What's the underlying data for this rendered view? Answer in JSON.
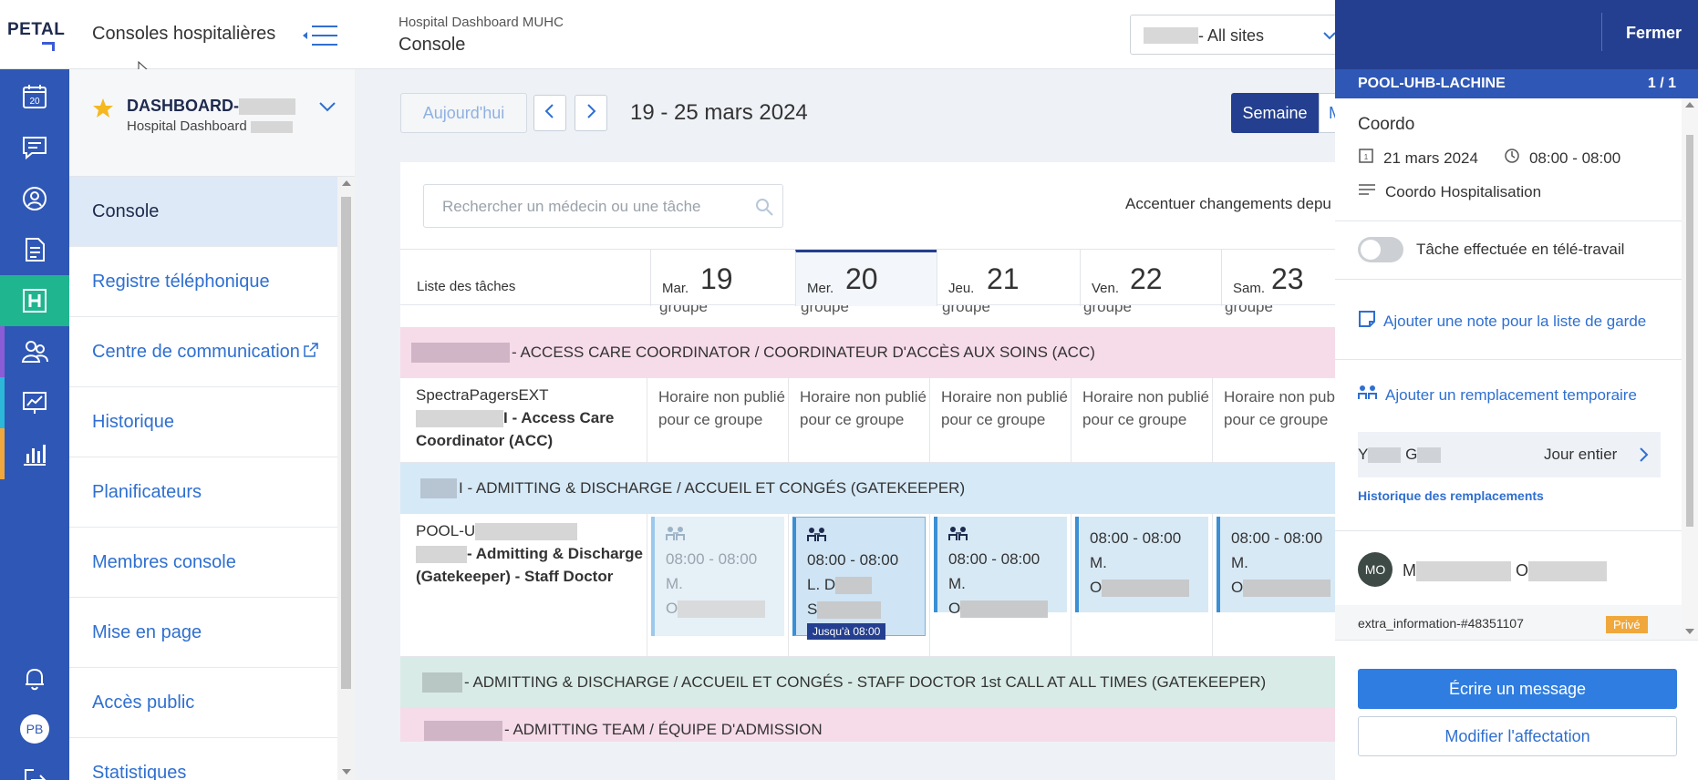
{
  "brand": {
    "logo_text": "PETAL"
  },
  "header": {
    "app_title": "Consoles hospitalières",
    "dashboard_subtitle": "Hospital Dashboard MUHC",
    "dashboard_title": "Console",
    "site_select_value": "- All sites"
  },
  "rail": {
    "calendar_day": "20",
    "user_initials": "PB"
  },
  "sidebar": {
    "dashboard_name": "DASHBOARD-",
    "dashboard_desc": "Hospital Dashboard",
    "items": [
      {
        "label": "Console",
        "active": true
      },
      {
        "label": "Registre téléphonique"
      },
      {
        "label": "Centre de communication",
        "external": true
      },
      {
        "label": "Historique"
      },
      {
        "label": "Planificateurs"
      },
      {
        "label": "Membres console"
      },
      {
        "label": "Mise en page"
      },
      {
        "label": "Accès public"
      },
      {
        "label": "Statistiques"
      }
    ]
  },
  "toolbar": {
    "today_label": "Aujourd'hui",
    "date_range": "19 - 25 mars 2024",
    "week_label": "Semaine",
    "month_label": "M"
  },
  "grid": {
    "search_placeholder": "Rechercher un médecin ou une tâche",
    "accent_label": "Accentuer changements depu",
    "task_list_header": "Liste des tâches",
    "days": [
      {
        "name": "Mar.",
        "num": "19"
      },
      {
        "name": "Mer.",
        "num": "20",
        "today": true
      },
      {
        "name": "Jeu.",
        "num": "21"
      },
      {
        "name": "Ven.",
        "num": "22"
      },
      {
        "name": "Sam.",
        "num": "23"
      }
    ],
    "partial_text": "groupe",
    "band1": "- ACCESS CARE COORDINATOR / COORDINATEUR D'ACCÈS AUX SOINS (ACC)",
    "row1": {
      "line1": "SpectraPagersEXT",
      "line2": "I - Access Care",
      "line3": "Coordinator (ACC)",
      "cells": [
        "Horaire non publié pour ce groupe",
        "Horaire non publié pour ce groupe",
        "Horaire non publié pour ce groupe",
        "Horaire non publié pour ce groupe",
        "Horaire non publié pour ce groupe"
      ]
    },
    "band2": "I - ADMITTING & DISCHARGE / ACCUEIL ET CONGÉS (GATEKEEPER)",
    "row2": {
      "line1": "POOL-U",
      "line2": "- Admitting & Discharge",
      "line3": "(Gatekeeper) - Staff Doctor",
      "shifts": [
        {
          "time": "08:00 - 08:00",
          "l1": "M.",
          "l2": "O",
          "l3": ""
        },
        {
          "time": "08:00 - 08:00",
          "l1": "L. D",
          "l2": "S",
          "badge": "Jusqu'à 08:00"
        },
        {
          "time": "08:00 - 08:00",
          "l1": "M.",
          "l2": "O"
        },
        {
          "time": "08:00 - 08:00",
          "l1": "M.",
          "l2": "O"
        },
        {
          "time": "08:00 - 08:00",
          "l1": "M.",
          "l2": "O"
        }
      ]
    },
    "band3": "- ADMITTING & DISCHARGE / ACCUEIL ET CONGÉS - STAFF DOCTOR 1st CALL AT ALL TIMES (GATEKEEPER)",
    "band4": "- ADMITTING TEAM / ÉQUIPE D'ADMISSION"
  },
  "detail": {
    "close_label": "Fermer",
    "pool": "POOL-UHB-LACHINE",
    "pager": "1 / 1",
    "title": "Coordo",
    "date": "21 mars 2024",
    "time": "08:00 - 08:00",
    "description": "Coordo Hospitalisation",
    "telework_label": "Tâche effectuée en télé-travail",
    "add_note": "Ajouter une note pour la liste de garde",
    "add_replacement": "Ajouter un remplacement temporaire",
    "replacement_name_a": "Y",
    "replacement_name_b": "G",
    "replacement_duration": "Jour entier",
    "history_link": "Historique des remplacements",
    "avatar_initials": "MO",
    "person_a": "M",
    "person_b": "O",
    "extra_info": "extra_information-#48351107",
    "private_badge": "Privé",
    "write_message": "Écrire un message",
    "modify_assignment": "Modifier l'affectation"
  }
}
